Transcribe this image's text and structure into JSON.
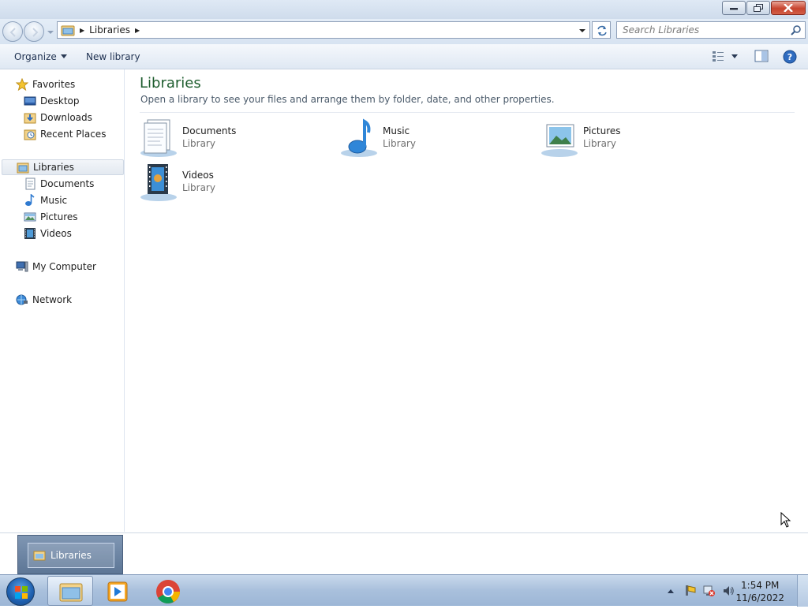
{
  "window": {
    "title": "",
    "controls": {
      "minimize": "minimize",
      "restore": "restore",
      "close": "close"
    }
  },
  "address": {
    "path": [
      "Libraries"
    ],
    "search_placeholder": "Search Libraries"
  },
  "toolbar": {
    "organize_label": "Organize",
    "new_library_label": "New library"
  },
  "sidebar": {
    "favorites": {
      "label": "Favorites",
      "items": [
        {
          "label": "Desktop",
          "icon": "desktop-icon"
        },
        {
          "label": "Downloads",
          "icon": "downloads-icon"
        },
        {
          "label": "Recent Places",
          "icon": "recent-places-icon"
        }
      ]
    },
    "libraries": {
      "label": "Libraries",
      "selected": true,
      "items": [
        {
          "label": "Documents",
          "icon": "documents-icon"
        },
        {
          "label": "Music",
          "icon": "music-icon"
        },
        {
          "label": "Pictures",
          "icon": "pictures-icon"
        },
        {
          "label": "Videos",
          "icon": "videos-icon"
        }
      ]
    },
    "computer": {
      "label": "My Computer"
    },
    "network": {
      "label": "Network"
    }
  },
  "main": {
    "title": "Libraries",
    "description": "Open a library to see your files and arrange them by folder, date, and other properties.",
    "libraries": [
      {
        "name": "Documents",
        "type": "Library",
        "icon": "documents-library-icon"
      },
      {
        "name": "Music",
        "type": "Library",
        "icon": "music-library-icon"
      },
      {
        "name": "Pictures",
        "type": "Library",
        "icon": "pictures-library-icon"
      },
      {
        "name": "Videos",
        "type": "Library",
        "icon": "videos-library-icon"
      }
    ]
  },
  "taskbar": {
    "preview_label": "Libraries",
    "apps": [
      "windows-explorer",
      "media-player",
      "chrome"
    ],
    "clock": {
      "time": "1:54 PM",
      "date": "11/6/2022"
    }
  },
  "colors": {
    "title_green": "#1e5d2e",
    "accent_blue": "#1e5fae",
    "taskbar": "#a9c0dc"
  }
}
